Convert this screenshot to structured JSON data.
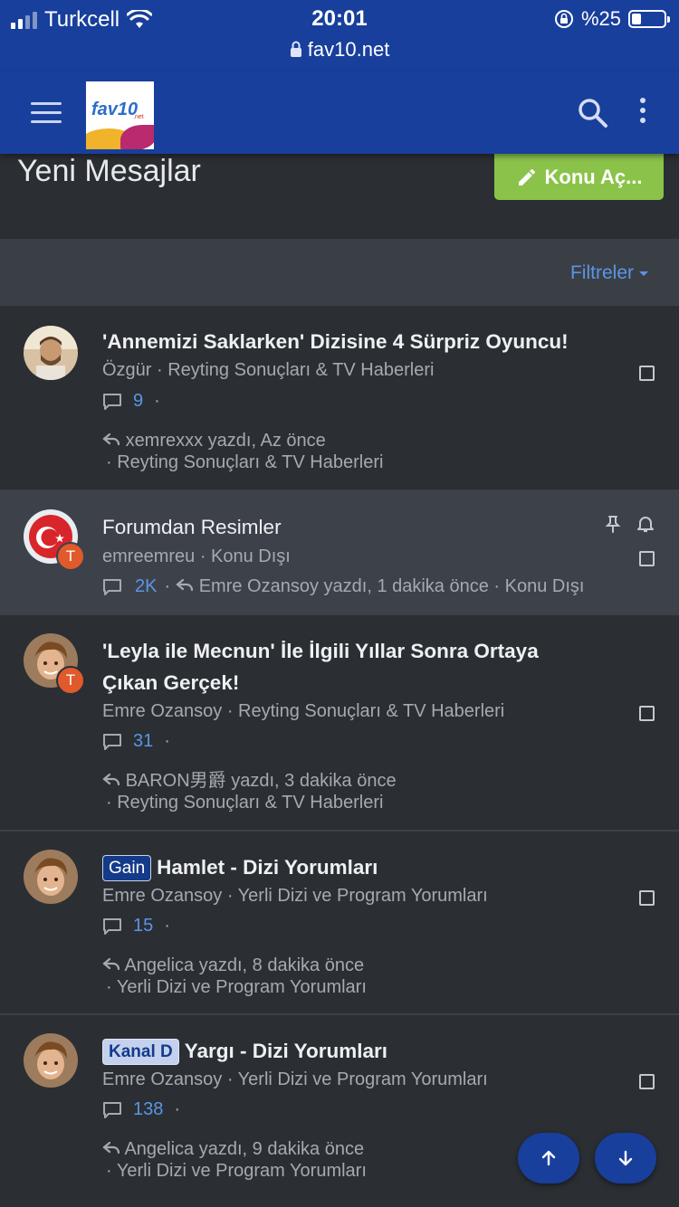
{
  "status_bar": {
    "carrier": "Turkcell",
    "time": "20:01",
    "url": "fav10.net",
    "battery_text": "%25",
    "battery_level": 0.25
  },
  "navbar": {
    "logo_text": "fav10",
    "logo_suffix": ".net",
    "icons": [
      "menu-icon",
      "search-icon",
      "more-vertical-icon"
    ]
  },
  "page": {
    "title": "Yeni Mesajlar",
    "new_thread_label": "Konu Aç...",
    "filter_label": "Filtreler"
  },
  "threads": [
    {
      "title": "'Annemizi Saklarken' Dizisine 4 Sürpriz Oyuncu!",
      "meta": "Özgür · Reyting Sonuçları & TV Haberleri",
      "replies": "9",
      "last_post": "xemrexxx yazdı, Az önce",
      "last_forum": "· Reyting Sonuçları & TV Haberleri"
    },
    {
      "title": "Forumdan Resimler",
      "meta": "emreemreu · Konu Dışı",
      "replies": "2K",
      "last_post": "Emre Ozansoy yazdı, 1 dakika önce · Konu Dışı",
      "avatar_badge": "T"
    },
    {
      "title_line1": "'Leyla ile Mecnun' İle İlgili Yıllar Sonra Ortaya",
      "title_line2": "Çıkan Gerçek!",
      "meta": "Emre Ozansoy · Reyting Sonuçları & TV Haberleri",
      "replies": "31",
      "last_post": "BARON男爵 yazdı, 3 dakika önce",
      "last_forum": "· Reyting Sonuçları & TV Haberleri",
      "avatar_badge": "T"
    },
    {
      "prefix": "Gain",
      "title": "Hamlet - Dizi Yorumları",
      "meta": "Emre Ozansoy · Yerli Dizi ve Program Yorumları",
      "replies": "15",
      "last_post": "Angelica yazdı, 8 dakika önce",
      "last_forum": "· Yerli Dizi ve Program Yorumları"
    },
    {
      "prefix": "Kanal D",
      "title": "Yargı - Dizi Yorumları",
      "meta": "Emre Ozansoy · Yerli Dizi ve Program Yorumları",
      "replies": "138",
      "last_post": "Angelica yazdı, 9 dakika önce",
      "last_forum": "· Yerli Dizi ve Program Yorumları"
    }
  ],
  "colors": {
    "brand_blue": "#183f9c",
    "accent_green": "#8bc34a",
    "link_blue": "#5b95e6",
    "background": "#2b2f34"
  }
}
